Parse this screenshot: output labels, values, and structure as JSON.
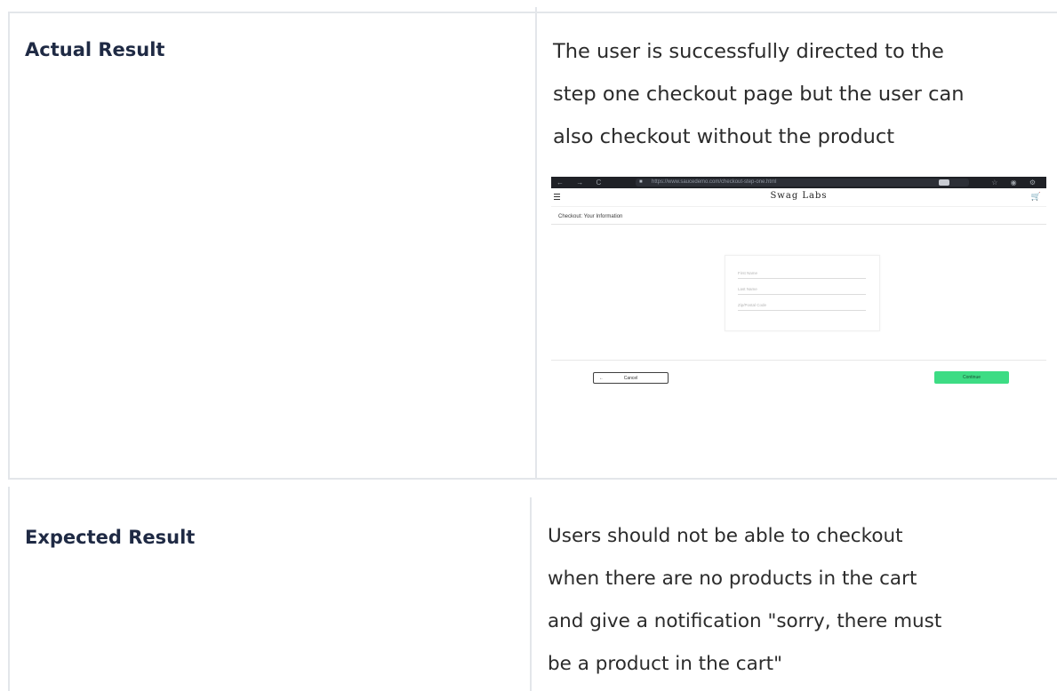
{
  "rows": [
    {
      "label": "Actual Result",
      "text_lines": [
        "The user is successfully directed to the",
        "step one checkout page but the user can",
        "also checkout without the product"
      ],
      "screenshot": {
        "browser": {
          "url": "https://www.saucedemo.com/checkout-step-one.html",
          "nav_icons": "← → C",
          "right_icons": "☆ ◉ ⚙"
        },
        "app_title": "Swag Labs",
        "page_subtitle": "Checkout: Your Information",
        "fields": [
          {
            "placeholder": "First Name"
          },
          {
            "placeholder": "Last Name"
          },
          {
            "placeholder": "Zip/Postal Code"
          }
        ],
        "cancel_label": "Cancel",
        "continue_label": "Continue",
        "accent_color": "#3ddc84"
      }
    },
    {
      "label": "Expected Result",
      "text_lines": [
        "Users should not be able to checkout",
        "when there are no products in the cart",
        "and give a notification \"sorry, there must",
        "be a product in the cart\""
      ]
    }
  ],
  "colors": {
    "label_text": "#1f2a44",
    "body_text": "#2b2b2b",
    "grid_line": "#e3e6ea"
  }
}
